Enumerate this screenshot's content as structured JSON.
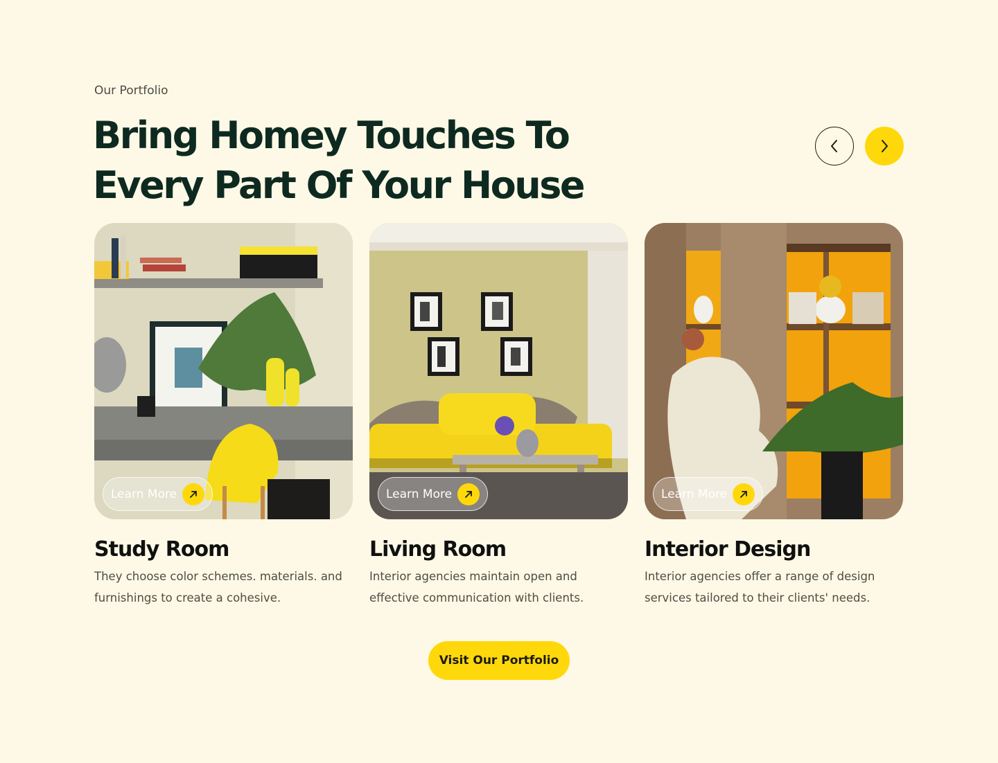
{
  "section": {
    "eyebrow": "Our Portfolio",
    "headline_line1": "Bring Homey Touches To",
    "headline_line2": "Every Part Of Your House"
  },
  "nav": {
    "prev_icon": "chevron-left-icon",
    "next_icon": "chevron-right-icon"
  },
  "cards": [
    {
      "title": "Study Room",
      "description": "They choose color schemes. materials. and furnishings to create a cohesive.",
      "button_label": "Learn More",
      "image": "study-room-photo"
    },
    {
      "title": "Living Room",
      "description": "Interior agencies maintain open and effective communication with clients.",
      "button_label": "Learn More",
      "image": "living-room-photo"
    },
    {
      "title": "Interior Design",
      "description": "Interior agencies offer a range of design services tailored to their clients' needs.",
      "button_label": "Learn More",
      "image": "interior-design-photo"
    }
  ],
  "cta": {
    "label": "Visit Our Portfolio"
  },
  "colors": {
    "background": "#FEF9E6",
    "accent": "#FFD80B",
    "heading": "#0E2A20",
    "body_text": "#4D4D45"
  }
}
